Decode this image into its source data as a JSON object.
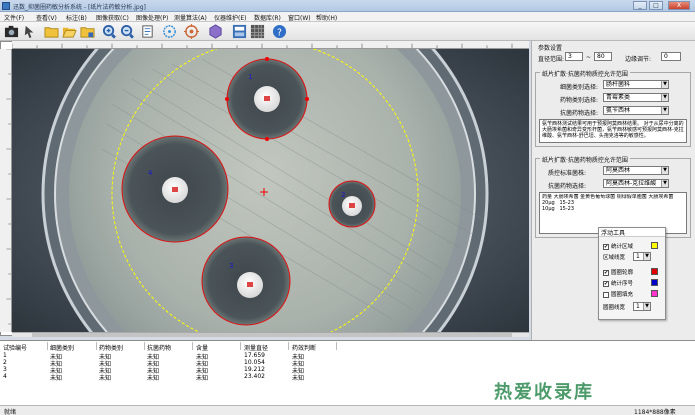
{
  "window": {
    "title": "迅数_抑菌圈药敏分析系统 - [纸片法药敏分析.jpg]",
    "buttons": {
      "minimize": "_",
      "maximize": "□",
      "close": "X"
    }
  },
  "menu": [
    "文件(F)",
    "查看(V)",
    "标注(B)",
    "图像获取(C)",
    "图像处理(P)",
    "测量算法(A)",
    "仪器维护(E)",
    "数据库(R)",
    "窗口(W)",
    "帮助(H)"
  ],
  "toolbar": {
    "icons": [
      "camera-icon",
      "pointer-icon",
      "folder-icon",
      "open-folder-icon",
      "save-folder-icon",
      "zoom-in-icon",
      "zoom-out-icon",
      "fit-icon",
      "circle-select-icon",
      "target-icon",
      "hexagon-icon",
      "settings-icon",
      "grid-icon",
      "help-icon"
    ]
  },
  "plate": {
    "zones": [
      {
        "id": "1",
        "label": "1"
      },
      {
        "id": "2",
        "label": "2"
      },
      {
        "id": "3",
        "label": "3"
      },
      {
        "id": "4",
        "label": "4"
      }
    ]
  },
  "params": {
    "section_title": "参数设置",
    "diameter_label": "直径范围:",
    "diameter_min": "3",
    "tilde": "~",
    "diameter_max": "80",
    "edge_label": "边缘调节:",
    "edge_value": "0"
  },
  "disk_std": {
    "group_title": "纸片扩散·抗菌药物质控允许范围",
    "bacteria_label": "细菌类别选择:",
    "bacteria_value": "肠杆菌科",
    "drug_class_label": "药物类别选择:",
    "drug_class_value": "青霉素类",
    "drug_label": "抗菌药物选择:",
    "drug_value": "氨苄西林",
    "note": "氨苄西林测试结果可用于预报阿莫西林结果。 对于从尿中分离的大肠埃希菌和奇异变形杆菌，氨苄西林敏感可预报阿莫西林-克拉维酸、氨苄西林-舒巴坦、头孢克洛等的敏感性。"
  },
  "disk_qc": {
    "group_title": "纸片扩散·抗菌药物质控允许范围",
    "std_label": "质控标准菌株:",
    "std_value": "阿莫西林",
    "drug_label": "抗菌药物选择:",
    "drug_value": "阿莫西林-克拉维酸",
    "table_header": "药量  大肠埃希菌  金黄色葡萄球菌  铜绿假单胞菌  大肠埃希菌",
    "rows": [
      {
        "dose": "20μg",
        "range": "15-23"
      },
      {
        "dose": "10μg",
        "range": "15-23"
      }
    ]
  },
  "float_tool": {
    "title": "浮动工具",
    "stat_zone": "统计区域",
    "zone_line": "区域线宽",
    "zone_line_value": "1",
    "circle_outline": "圆圈轮廓",
    "stat_marker": "统计序号",
    "circle_fill": "圆圈填充",
    "circle_line": "圆圈线宽",
    "circle_line_value": "1",
    "colors": {
      "zone": "#ffff00",
      "outline": "#e00000",
      "marker": "#0000cc",
      "fill": "#ff33cc"
    }
  },
  "table": {
    "headers": [
      "试验编号",
      "细菌类别",
      "药物类别",
      "抗菌药物",
      "含量",
      "测量直径",
      "药效判断"
    ],
    "rows": [
      [
        "1",
        "未知",
        "未知",
        "未知",
        "未知",
        "17.659",
        "未知"
      ],
      [
        "2",
        "未知",
        "未知",
        "未知",
        "未知",
        "10.054",
        "未知"
      ],
      [
        "3",
        "未知",
        "未知",
        "未知",
        "未知",
        "19.212",
        "未知"
      ],
      [
        "4",
        "未知",
        "未知",
        "未知",
        "未知",
        "23.402",
        "未知"
      ]
    ]
  },
  "status": {
    "left": "就绪",
    "resolution": "1184*888像素"
  },
  "watermark": "热爱收录库"
}
